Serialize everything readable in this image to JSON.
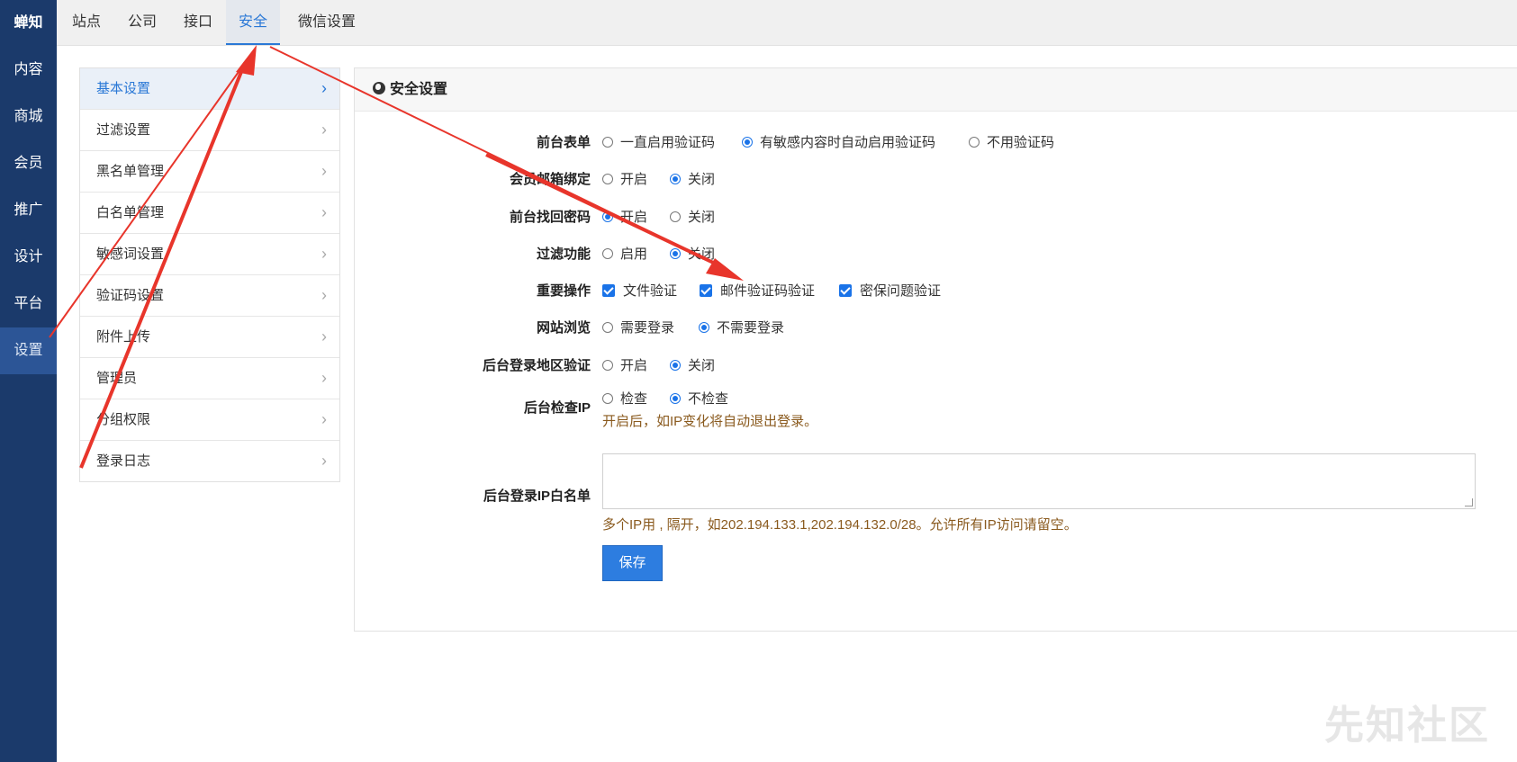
{
  "nav": {
    "brand": "蝉知",
    "items": [
      {
        "label": "内容",
        "active": false
      },
      {
        "label": "商城",
        "active": false
      },
      {
        "label": "会员",
        "active": false
      },
      {
        "label": "推广",
        "active": false
      },
      {
        "label": "设计",
        "active": false
      },
      {
        "label": "平台",
        "active": false
      },
      {
        "label": "设置",
        "active": true
      }
    ]
  },
  "tabs": [
    {
      "label": "站点",
      "active": false
    },
    {
      "label": "公司",
      "active": false
    },
    {
      "label": "接口",
      "active": false
    },
    {
      "label": "安全",
      "active": true
    },
    {
      "label": "微信设置",
      "active": false
    }
  ],
  "submenu": [
    {
      "label": "基本设置",
      "active": true
    },
    {
      "label": "过滤设置",
      "active": false
    },
    {
      "label": "黑名单管理",
      "active": false
    },
    {
      "label": "白名单管理",
      "active": false
    },
    {
      "label": "敏感词设置",
      "active": false
    },
    {
      "label": "验证码设置",
      "active": false
    },
    {
      "label": "附件上传",
      "active": false
    },
    {
      "label": "管理员",
      "active": false
    },
    {
      "label": "分组权限",
      "active": false
    },
    {
      "label": "登录日志",
      "active": false
    }
  ],
  "panel": {
    "title": "安全设置",
    "rows": {
      "front_form": {
        "label": "前台表单",
        "options": [
          "一直启用验证码",
          "有敏感内容时自动启用验证码",
          "不用验证码"
        ],
        "selected": 1
      },
      "member_email": {
        "label": "会员邮箱绑定",
        "options": [
          "开启",
          "关闭"
        ],
        "selected": 1
      },
      "front_recover": {
        "label": "前台找回密码",
        "options": [
          "开启",
          "关闭"
        ],
        "selected": 0
      },
      "filter": {
        "label": "过滤功能",
        "options": [
          "启用",
          "关闭"
        ],
        "selected": 1
      },
      "important_ops": {
        "label": "重要操作",
        "options": [
          "文件验证",
          "邮件验证码验证",
          "密保问题验证"
        ],
        "checked": [
          true,
          true,
          true
        ]
      },
      "site_browse": {
        "label": "网站浏览",
        "options": [
          "需要登录",
          "不需要登录"
        ],
        "selected": 1
      },
      "login_region": {
        "label": "后台登录地区验证",
        "options": [
          "开启",
          "关闭"
        ],
        "selected": 1
      },
      "check_ip": {
        "label": "后台检查IP",
        "options": [
          "检查",
          "不检查"
        ],
        "selected": 1,
        "hint": "开启后，如IP变化将自动退出登录。"
      },
      "ip_whitelist": {
        "label": "后台登录IP白名单",
        "value": "",
        "hint": "多个IP用 , 隔开，如202.194.133.1,202.194.132.0/28。允许所有IP访问请留空。"
      }
    },
    "save_label": "保存"
  },
  "watermark": "先知社区",
  "colors": {
    "nav_bg": "#1b3a6b",
    "accent": "#2a78d6",
    "arrow": "#e8352b",
    "hint": "#8a5a1e"
  }
}
